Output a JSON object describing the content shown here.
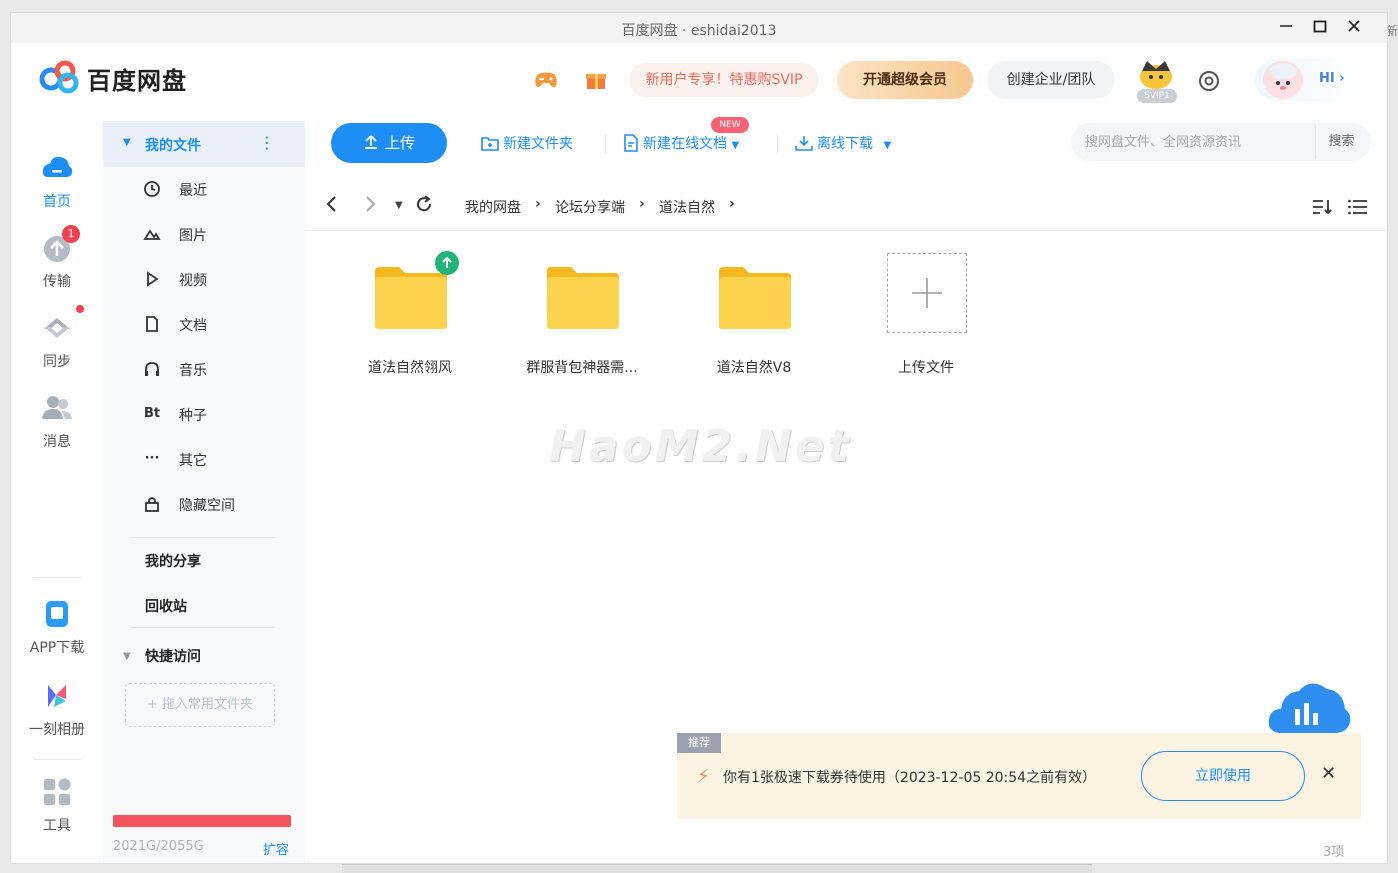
{
  "window": {
    "title": "百度网盘 · eshidai2013",
    "edge_text": "新"
  },
  "header": {
    "app_name": "百度网盘",
    "promo": "新用户专享！特惠购SVIP",
    "vip_button": "开通超级会员",
    "team_button": "创建企业/团队",
    "svip_badge": "SVIP1",
    "avatar_greeting": "HI ›"
  },
  "left_rail": {
    "items": [
      {
        "label": "首页",
        "icon": "cloud-home-icon",
        "active": true
      },
      {
        "label": "传输",
        "icon": "transfer-icon",
        "badge": "1"
      },
      {
        "label": "同步",
        "icon": "sync-icon"
      },
      {
        "label": "消息",
        "icon": "message-icon"
      },
      {
        "label": "APP下载",
        "icon": "app-download-icon"
      },
      {
        "label": "一刻相册",
        "icon": "album-icon"
      },
      {
        "label": "工具",
        "icon": "tools-icon"
      }
    ]
  },
  "sidebar": {
    "header": "我的文件",
    "more": "⋮",
    "items": [
      {
        "label": "最近",
        "icon": "clock-icon"
      },
      {
        "label": "图片",
        "icon": "image-icon"
      },
      {
        "label": "视频",
        "icon": "play-icon"
      },
      {
        "label": "文档",
        "icon": "document-icon"
      },
      {
        "label": "音乐",
        "icon": "headphones-icon"
      },
      {
        "label": "种子",
        "icon": "bt-icon",
        "glyph": "Bt"
      },
      {
        "label": "其它",
        "icon": "more-dots-icon",
        "glyph": "···"
      },
      {
        "label": "隐藏空间",
        "icon": "lock-icon"
      }
    ],
    "my_share": "我的分享",
    "recycle_bin": "回收站",
    "quick_access": "快捷访问",
    "drop_zone": "+ 拖入常用文件夹",
    "quota": "2021G/2055G",
    "quota_fraction": 0.983,
    "expand": "扩容"
  },
  "toolbar": {
    "upload": "上传",
    "new_folder": "新建文件夹",
    "new_online_doc": "新建在线文档",
    "new_badge": "NEW",
    "offline_download": "离线下载",
    "search_placeholder": "搜网盘文件、全网资源资讯",
    "search_button": "搜索"
  },
  "breadcrumb": [
    "我的网盘",
    "论坛分享端",
    "道法自然"
  ],
  "files": [
    {
      "name": "道法自然翎风",
      "type": "folder",
      "uploading": true
    },
    {
      "name": "群服背包神器需...",
      "type": "folder"
    },
    {
      "name": "道法自然V8",
      "type": "folder"
    }
  ],
  "upload_tile": "上传文件",
  "watermark": "HaoM2.Net",
  "promo_bar": {
    "tag": "推荐",
    "text": "你有1张极速下载券待使用（2023-12-05 20:54之前有效）",
    "button": "立即使用",
    "close": "✕"
  },
  "item_count": "3项",
  "colors": {
    "accent": "#1e8ef5",
    "folder": "#fcc832",
    "alert": "#f0424e",
    "quota_bar": "#f3545f"
  }
}
